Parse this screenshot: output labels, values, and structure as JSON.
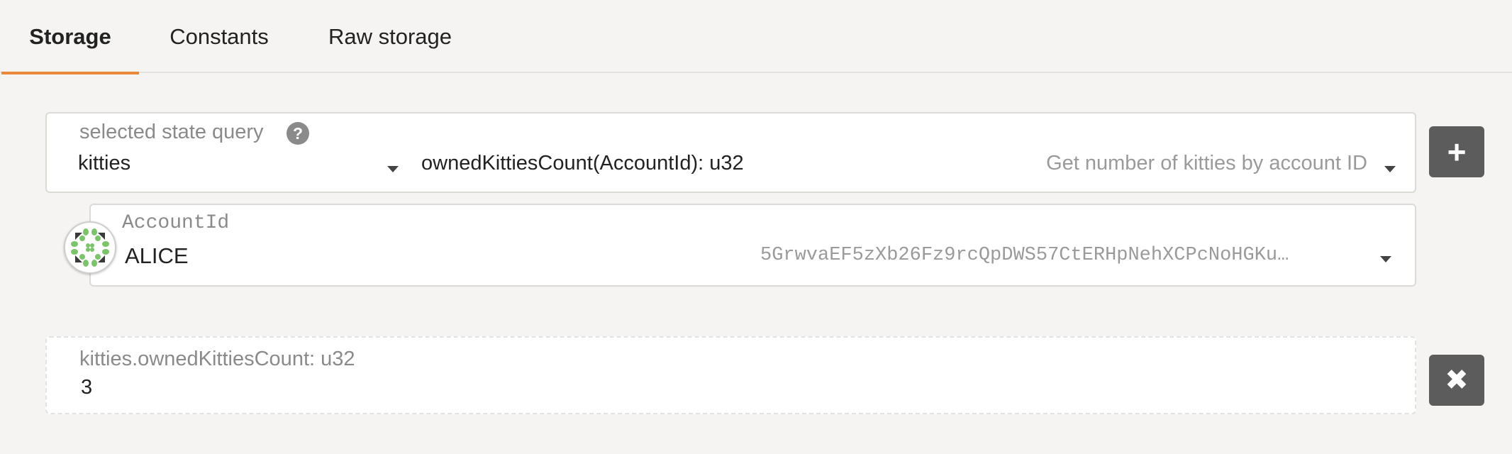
{
  "tabs": [
    {
      "label": "Storage",
      "active": true
    },
    {
      "label": "Constants",
      "active": false
    },
    {
      "label": "Raw storage",
      "active": false
    }
  ],
  "colors": {
    "accent": "#e8893a",
    "button_bg": "#5c5c5c",
    "identicon_green": "#7bc46b"
  },
  "query": {
    "label": "selected state query",
    "module": "kitties",
    "method": "ownedKittiesCount(AccountId): u32",
    "method_hint": "Get number of kitties by account ID",
    "add_button_icon": "plus-icon"
  },
  "account": {
    "label": "AccountId",
    "name": "ALICE",
    "address": "5GrwvaEF5zXb26Fz9rcQpDWS57CtERHpNehXCPcNoHGKu…",
    "avatar_icon": "identicon"
  },
  "result": {
    "label": "kitties.ownedKittiesCount: u32",
    "value": "3",
    "remove_button_icon": "close-icon"
  }
}
